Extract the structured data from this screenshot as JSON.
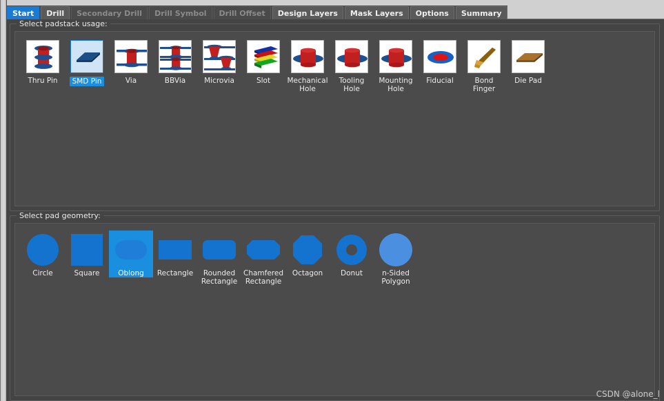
{
  "window": {
    "watermark": "CSDN @alone_l"
  },
  "tabs": [
    {
      "label": "Start",
      "state": "selected"
    },
    {
      "label": "Drill",
      "state": "enabled"
    },
    {
      "label": "Secondary Drill",
      "state": "disabled"
    },
    {
      "label": "Drill Symbol",
      "state": "disabled"
    },
    {
      "label": "Drill Offset",
      "state": "disabled"
    },
    {
      "label": "Design Layers",
      "state": "enabled"
    },
    {
      "label": "Mask Layers",
      "state": "enabled"
    },
    {
      "label": "Options",
      "state": "enabled"
    },
    {
      "label": "Summary",
      "state": "enabled"
    }
  ],
  "padstack_usage": {
    "legend": "Select padstack usage:",
    "items": [
      {
        "label": "Thru Pin",
        "icon": "thru-pin-icon",
        "selected": false
      },
      {
        "label": "SMD Pin",
        "icon": "smd-pin-icon",
        "selected": true
      },
      {
        "label": "Via",
        "icon": "via-icon",
        "selected": false
      },
      {
        "label": "BBVia",
        "icon": "bbvia-icon",
        "selected": false
      },
      {
        "label": "Microvia",
        "icon": "microvia-icon",
        "selected": false
      },
      {
        "label": "Slot",
        "icon": "slot-icon",
        "selected": false
      },
      {
        "label": "Mechanical Hole",
        "icon": "mechanical-hole-icon",
        "selected": false
      },
      {
        "label": "Tooling Hole",
        "icon": "tooling-hole-icon",
        "selected": false
      },
      {
        "label": "Mounting Hole",
        "icon": "mounting-hole-icon",
        "selected": false
      },
      {
        "label": "Fiducial",
        "icon": "fiducial-icon",
        "selected": false
      },
      {
        "label": "Bond Finger",
        "icon": "bond-finger-icon",
        "selected": false
      },
      {
        "label": "Die Pad",
        "icon": "die-pad-icon",
        "selected": false
      }
    ]
  },
  "pad_geometry": {
    "legend": "Select pad geometry:",
    "items": [
      {
        "label": "Circle",
        "icon": "circle-shape-icon",
        "selected": false
      },
      {
        "label": "Square",
        "icon": "square-shape-icon",
        "selected": false
      },
      {
        "label": "Oblong",
        "icon": "oblong-shape-icon",
        "selected": true
      },
      {
        "label": "Rectangle",
        "icon": "rectangle-shape-icon",
        "selected": false
      },
      {
        "label": "Rounded Rectangle",
        "icon": "rounded-rectangle-shape-icon",
        "selected": false
      },
      {
        "label": "Chamfered Rectangle",
        "icon": "chamfered-rectangle-shape-icon",
        "selected": false
      },
      {
        "label": "Octagon",
        "icon": "octagon-shape-icon",
        "selected": false
      },
      {
        "label": "Donut",
        "icon": "donut-shape-icon",
        "selected": false
      },
      {
        "label": "n-Sided Polygon",
        "icon": "n-sided-polygon-shape-icon",
        "selected": false
      }
    ]
  },
  "colors": {
    "accent_blue": "#1a7ad4",
    "highlight_blue": "#1a8fe0",
    "pad_blue": "#1373cf",
    "pad_light_blue": "#4a8fe0",
    "copper_red": "#c21f1f",
    "plating_blue": "#1f4f8f",
    "bond_gold": "#a0721a",
    "window_bg": "#444444",
    "panel_bg": "#4b4b4b"
  }
}
